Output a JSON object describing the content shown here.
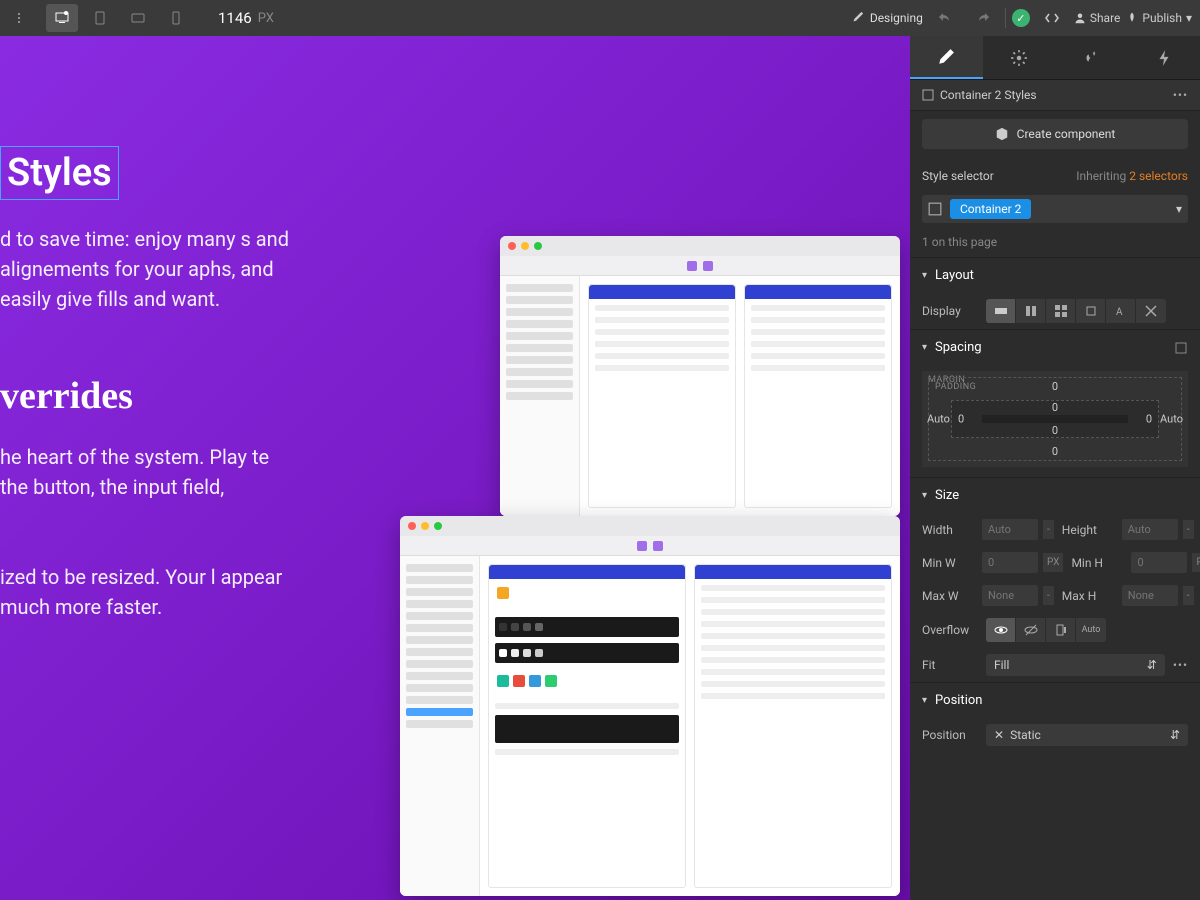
{
  "topbar": {
    "width_value": "1146",
    "width_unit": "PX",
    "mode": "Designing",
    "share": "Share",
    "publish": "Publish"
  },
  "canvas": {
    "sections": [
      {
        "title": "Styles",
        "body": "d to save time: enjoy many s and alignements for your aphs, and easily give fills and want."
      },
      {
        "title": "verrides",
        "body": "he heart of the system. Play te the button, the input field,"
      },
      {
        "title": "",
        "body": "ized to be resized. Your l appear much more faster."
      }
    ]
  },
  "panel": {
    "element_label": "Container 2 Styles",
    "create_component": "Create component",
    "style_selector_label": "Style selector",
    "inheriting_prefix": "Inheriting",
    "inheriting_count": "2 selectors",
    "selector_chip": "Container 2",
    "on_page": "1 on this page",
    "sections": {
      "layout": "Layout",
      "spacing": "Spacing",
      "size": "Size",
      "position": "Position"
    },
    "labels": {
      "display": "Display",
      "margin": "MARGIN",
      "padding": "PADDING",
      "auto": "Auto",
      "width": "Width",
      "height": "Height",
      "minw": "Min W",
      "minh": "Min H",
      "maxw": "Max W",
      "maxh": "Max H",
      "overflow": "Overflow",
      "fit": "Fit",
      "position_lbl": "Position"
    },
    "values": {
      "margin_top": "0",
      "margin_bottom": "0",
      "padding_top": "0",
      "padding_left": "0",
      "padding_right": "0",
      "padding_bottom": "0",
      "width": "Auto",
      "height": "Auto",
      "minw": "0",
      "minh": "0",
      "maxw": "None",
      "maxh": "None",
      "px": "PX",
      "fit": "Fill",
      "position": "Static"
    }
  }
}
